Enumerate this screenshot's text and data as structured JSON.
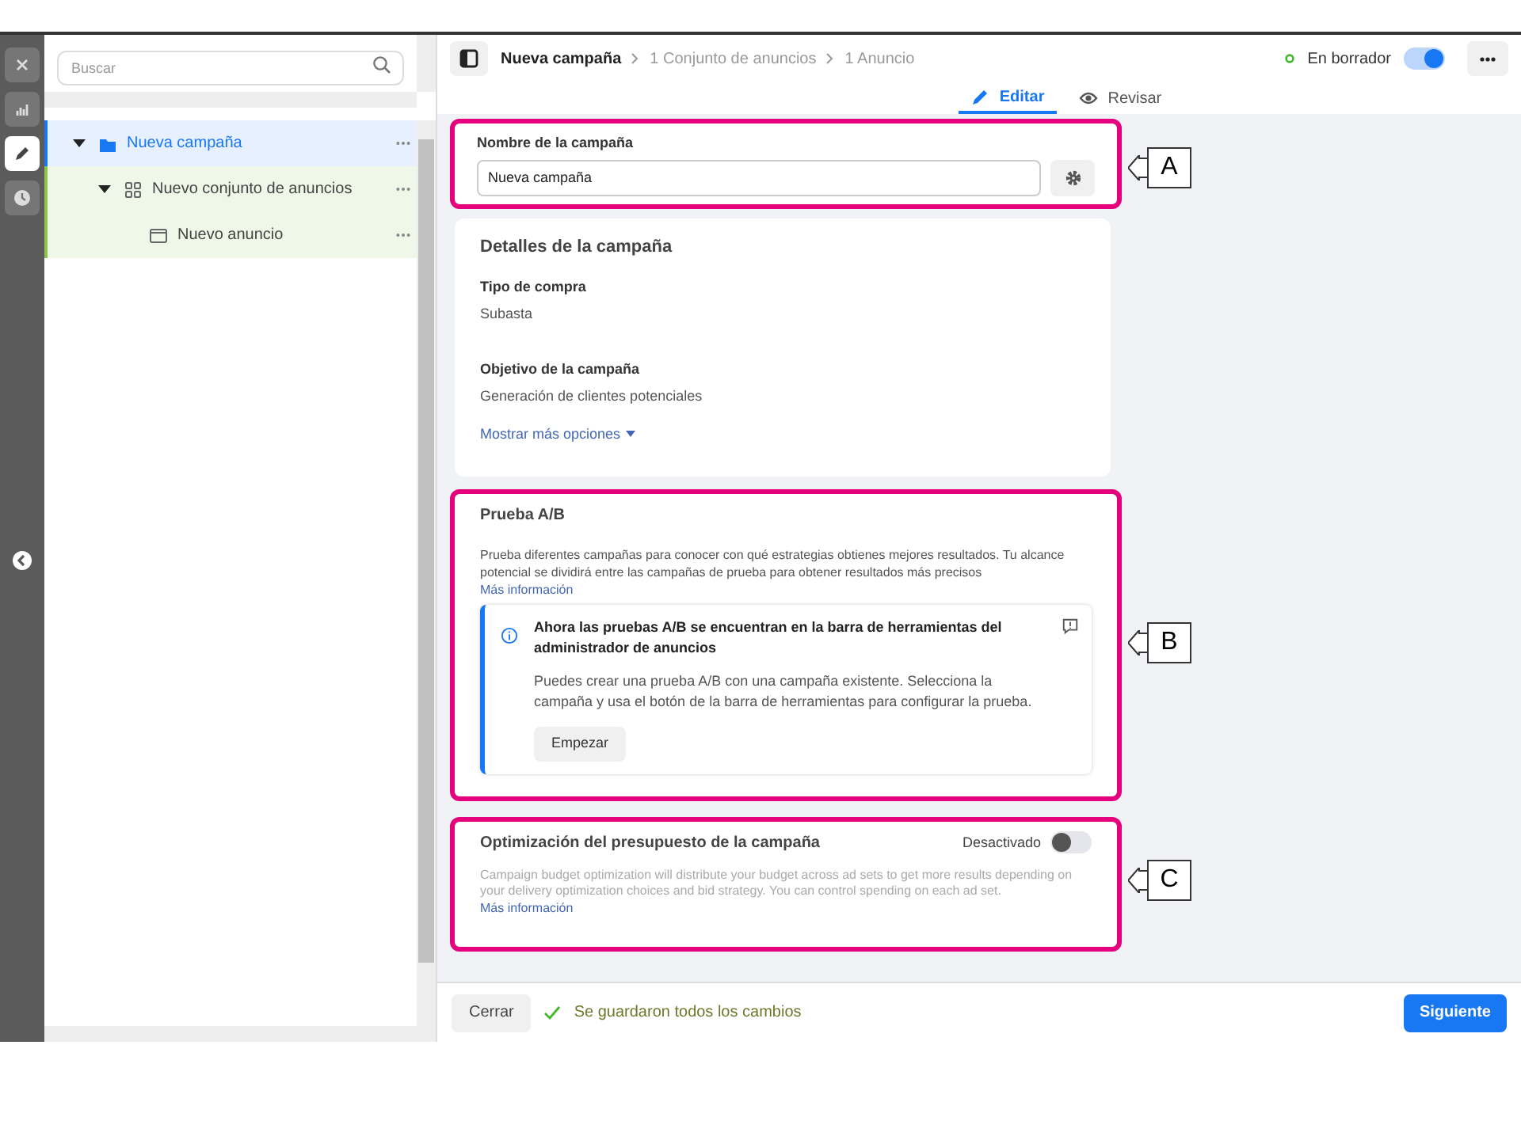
{
  "rail": [
    {
      "kind": "close",
      "selected": false
    },
    {
      "kind": "chart",
      "selected": false
    },
    {
      "kind": "edit",
      "selected": true
    },
    {
      "kind": "history",
      "selected": false
    }
  ],
  "search": {
    "placeholder": "Buscar"
  },
  "tree": [
    {
      "label": "Nueva campaña",
      "kind": "campaign",
      "selected": true,
      "expanded": true,
      "children": [
        {
          "label": "Nuevo conjunto de anuncios",
          "kind": "adset",
          "selected": false,
          "expanded": true,
          "children": [
            {
              "label": "Nuevo anuncio",
              "kind": "ad",
              "selected": false
            }
          ]
        }
      ]
    }
  ],
  "breadcrumb": [
    "Nueva campaña",
    "1 Conjunto de anuncios",
    "1 Anuncio"
  ],
  "status": {
    "label": "En borrador",
    "on": true
  },
  "tabs": [
    {
      "label": "Editar",
      "kind": "edit",
      "selected": true
    },
    {
      "label": "Revisar",
      "kind": "review",
      "selected": false
    }
  ],
  "name_card": {
    "title": "Nombre de la campaña",
    "value": "Nueva campaña",
    "callout": "A"
  },
  "details_card": {
    "title": "Detalles de la campaña",
    "fields": [
      {
        "label": "Tipo de compra",
        "value": "Subasta"
      },
      {
        "label": "Objetivo de la campaña",
        "value": "Generación de clientes potenciales"
      }
    ],
    "more": "Mostrar más opciones"
  },
  "ab_card": {
    "title": "Prueba A/B",
    "text": "Prueba diferentes campañas para conocer con qué estrategias obtienes mejores resultados. Tu alcance potencial se dividirá entre las campañas de prueba para obtener resultados más precisos",
    "link": "Más información",
    "notice": {
      "title": "Ahora las pruebas A/B se encuentran en la barra de herramientas del administrador de anuncios",
      "text": "Puedes crear una prueba A/B con una campaña existente. Selecciona la campaña y usa el botón de la barra de herramientas para configurar la prueba.",
      "button": "Empezar"
    },
    "callout": "B"
  },
  "budget_card": {
    "title": "Optimización del presupuesto de la campaña",
    "toggle_label": "Desactivado",
    "on": false,
    "text": "Campaign budget optimization will distribute your budget across ad sets to get more results depending on your delivery optimization choices and bid strategy. You can control spending on each ad set.",
    "link": "Más información",
    "callout": "C"
  },
  "footer": {
    "close": "Cerrar",
    "saved": "Se guardaron todos los cambios",
    "next": "Siguiente"
  }
}
